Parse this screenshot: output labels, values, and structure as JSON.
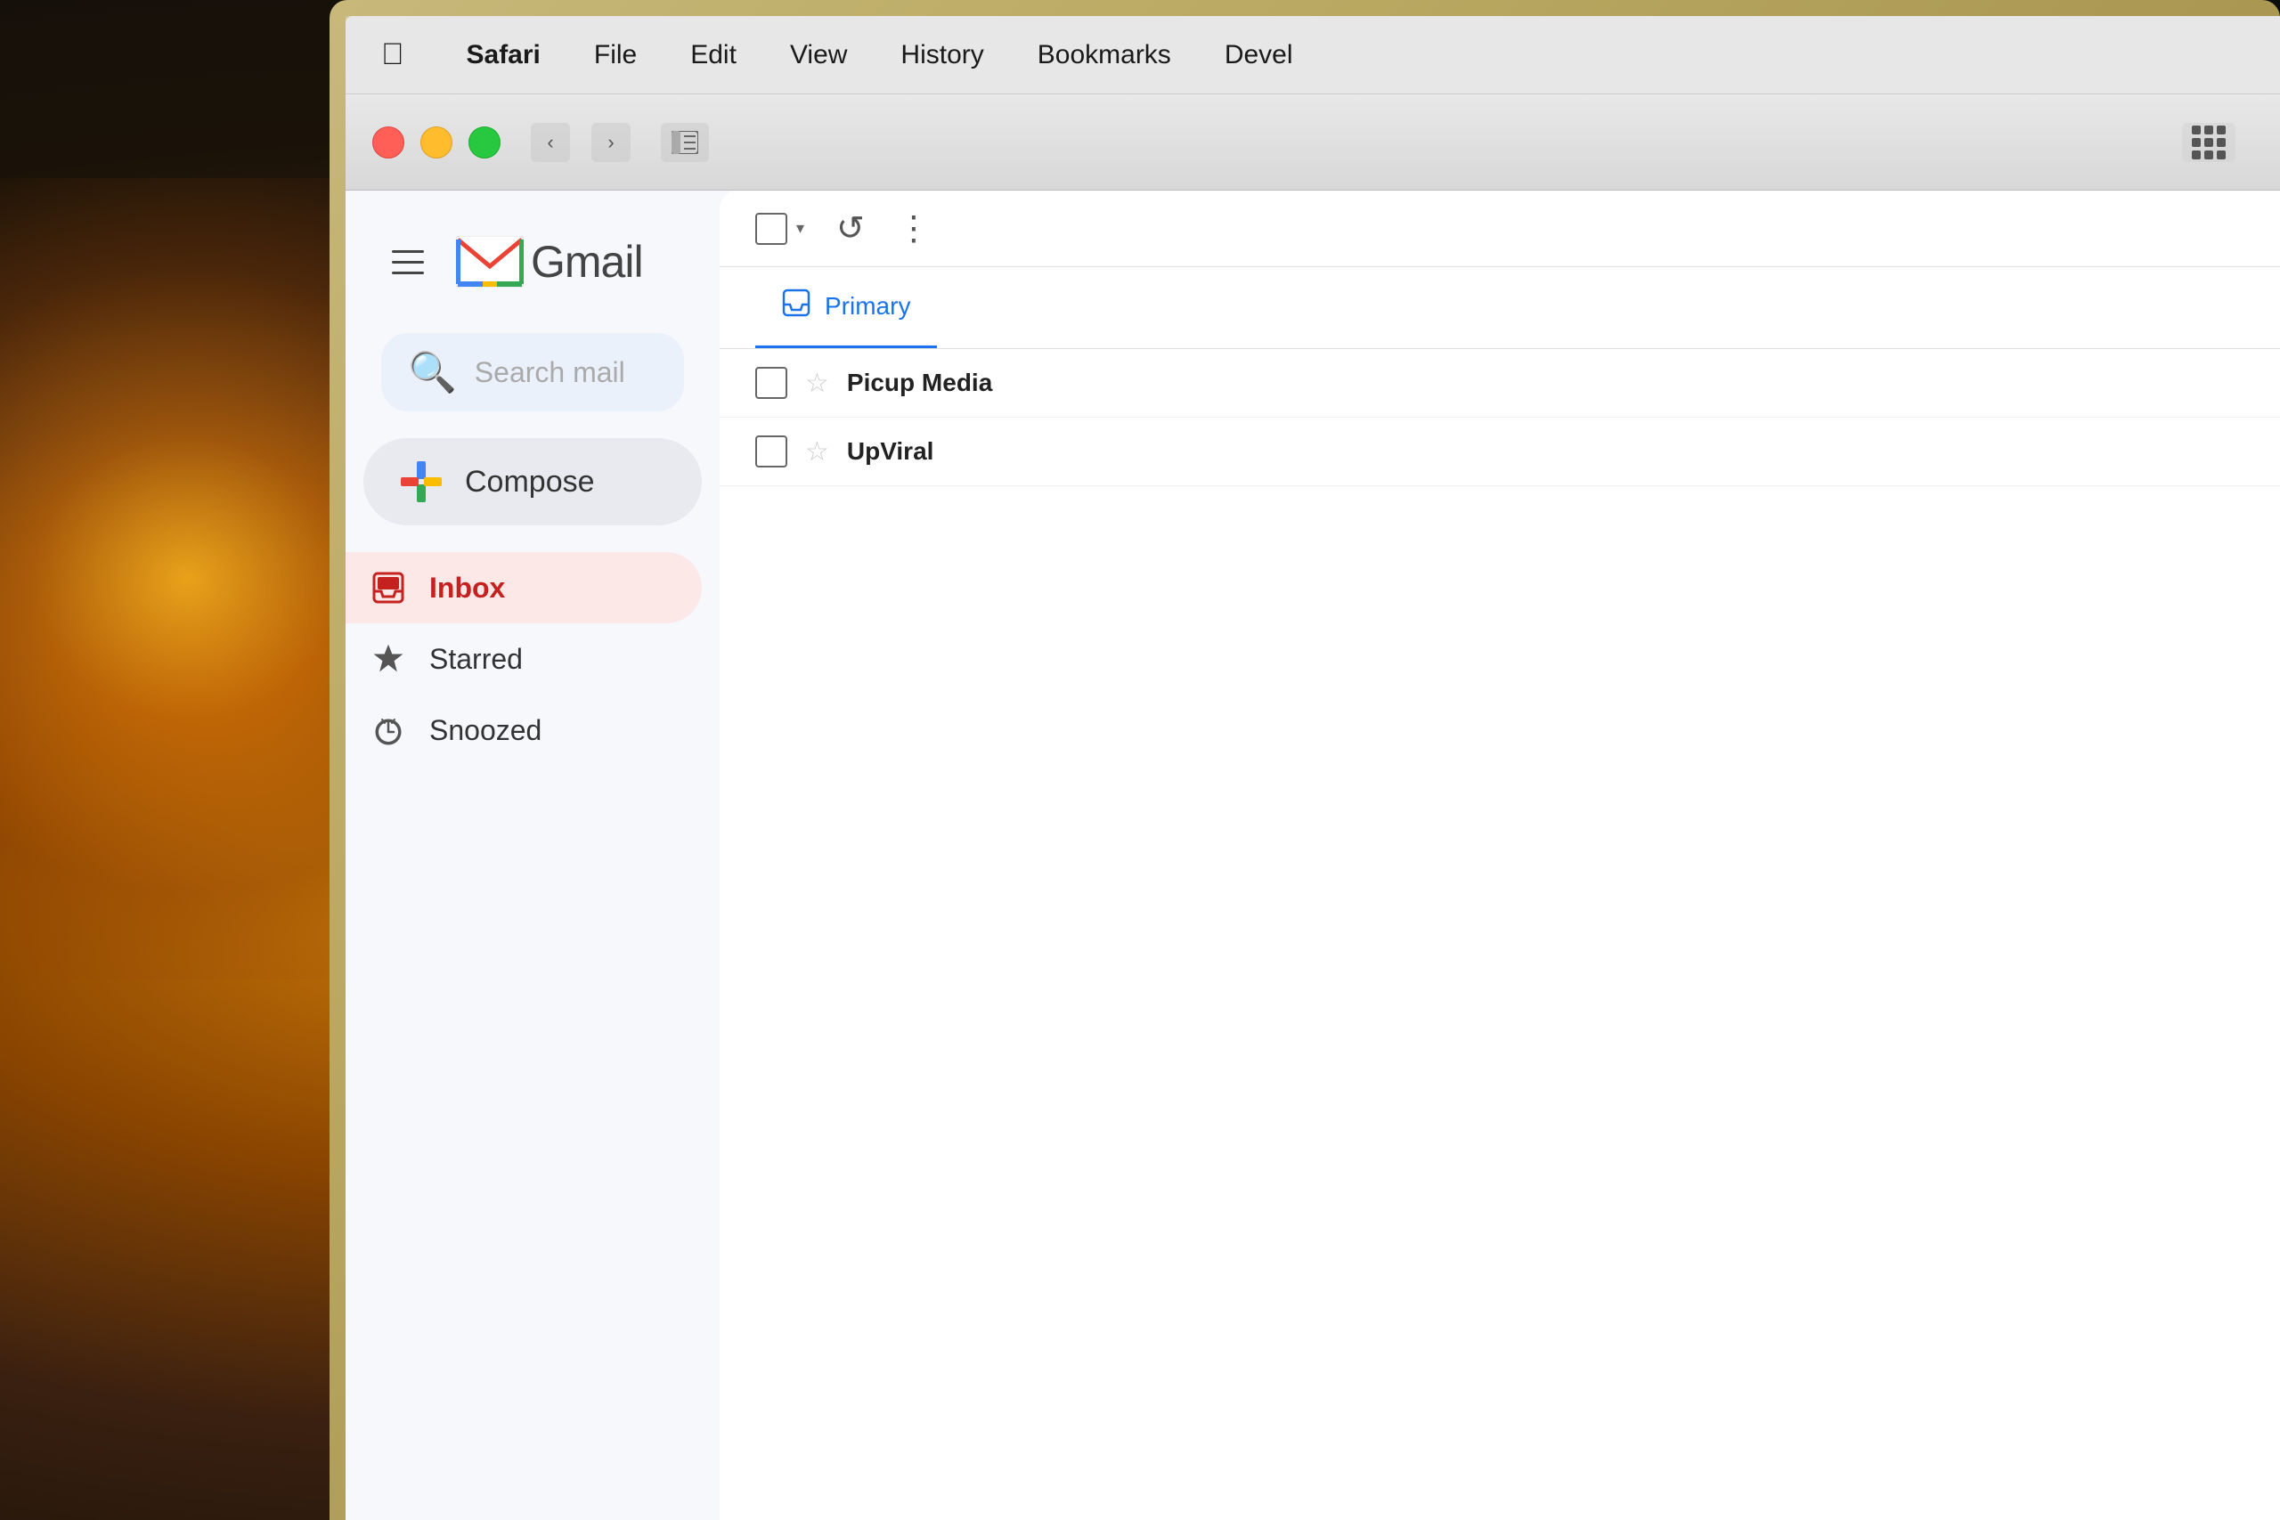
{
  "background": {
    "description": "Warm bokeh background with glowing light"
  },
  "menubar": {
    "apple_label": "",
    "items": [
      {
        "id": "safari",
        "label": "Safari",
        "bold": true
      },
      {
        "id": "file",
        "label": "File",
        "bold": false
      },
      {
        "id": "edit",
        "label": "Edit",
        "bold": false
      },
      {
        "id": "view",
        "label": "View",
        "bold": false
      },
      {
        "id": "history",
        "label": "History",
        "bold": false
      },
      {
        "id": "bookmarks",
        "label": "Bookmarks",
        "bold": false
      },
      {
        "id": "develop",
        "label": "Devel",
        "bold": false
      }
    ]
  },
  "browser": {
    "back_label": "‹",
    "forward_label": "›",
    "sidebar_icon": "⊞",
    "grid_icon": "⠿"
  },
  "gmail": {
    "logo_text": "Gmail",
    "search_placeholder": "Search mail",
    "compose_label": "Compose",
    "nav_items": [
      {
        "id": "inbox",
        "label": "Inbox",
        "active": true,
        "icon": "inbox"
      },
      {
        "id": "starred",
        "label": "Starred",
        "active": false,
        "icon": "star"
      },
      {
        "id": "snoozed",
        "label": "Snoozed",
        "active": false,
        "icon": "clock"
      }
    ],
    "tabs": [
      {
        "id": "primary",
        "label": "Primary",
        "active": true
      }
    ],
    "email_rows": [
      {
        "id": "1",
        "sender": "Picup Media",
        "starred": false
      },
      {
        "id": "2",
        "sender": "UpViral",
        "starred": false
      }
    ],
    "toolbar": {
      "refresh_icon": "↻",
      "more_icon": "⋮"
    }
  },
  "colors": {
    "gmail_red": "#c5221f",
    "gmail_blue": "#1a73e8",
    "inbox_bg": "#fce8e6",
    "compose_bg": "#e8eaf0",
    "search_bg": "#eaf1fb",
    "plus_red": "#ea4335",
    "plus_blue": "#4285f4",
    "plus_green": "#34a853",
    "plus_yellow": "#fbbc04"
  }
}
